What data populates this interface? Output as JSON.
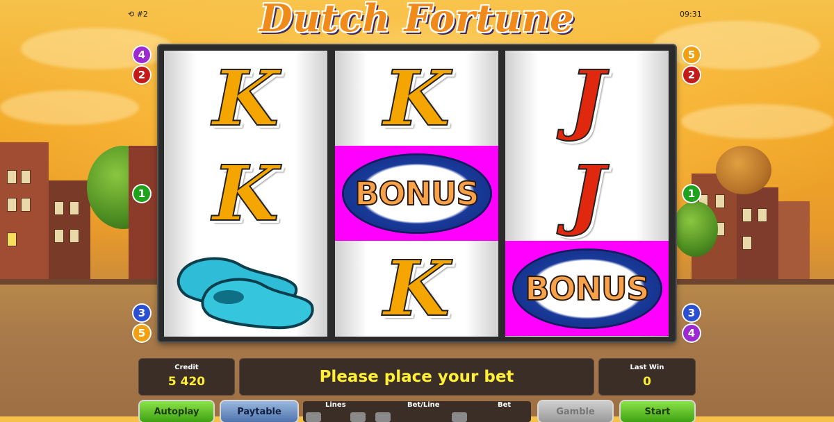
{
  "title": "Dutch Fortune",
  "top_left": {
    "icon": "replay-icon",
    "label": "#2"
  },
  "clock": "09:31",
  "reels": [
    [
      {
        "symbol": "K",
        "type": "letter",
        "color": "#f4a500"
      },
      {
        "symbol": "K",
        "type": "letter",
        "color": "#f4a500"
      },
      {
        "symbol": "clogs",
        "type": "image"
      }
    ],
    [
      {
        "symbol": "K",
        "type": "letter",
        "color": "#f4a500"
      },
      {
        "symbol": "BONUS",
        "type": "bonus",
        "highlight": "#ff00ff"
      },
      {
        "symbol": "K",
        "type": "letter",
        "color": "#f4a500"
      }
    ],
    [
      {
        "symbol": "J",
        "type": "letter",
        "color": "#e0280e"
      },
      {
        "symbol": "J",
        "type": "letter",
        "color": "#e0280e"
      },
      {
        "symbol": "BONUS",
        "type": "bonus",
        "highlight": "#ff00ff"
      }
    ]
  ],
  "paylines_left": [
    {
      "n": "4",
      "color": "#9b2bd1"
    },
    {
      "n": "2",
      "color": "#c41a1a"
    },
    {
      "n": "1",
      "color": "#1fa31f"
    },
    {
      "n": "3",
      "color": "#2a4fd0"
    },
    {
      "n": "5",
      "color": "#f0a010"
    }
  ],
  "paylines_right": [
    {
      "n": "5",
      "color": "#f0a010"
    },
    {
      "n": "2",
      "color": "#c41a1a"
    },
    {
      "n": "1",
      "color": "#1fa31f"
    },
    {
      "n": "3",
      "color": "#2a4fd0"
    },
    {
      "n": "4",
      "color": "#9b2bd1"
    }
  ],
  "credit": {
    "label": "Credit",
    "value": "5 420"
  },
  "message": "Please place your bet",
  "last_win": {
    "label": "Last Win",
    "value": "0"
  },
  "bet_labels": {
    "lines": "Lines",
    "bet_line": "Bet/Line",
    "bet": "Bet"
  },
  "buttons": {
    "autoplay": "Autoplay",
    "paytable": "Paytable",
    "gamble": "Gamble",
    "start": "Start"
  }
}
